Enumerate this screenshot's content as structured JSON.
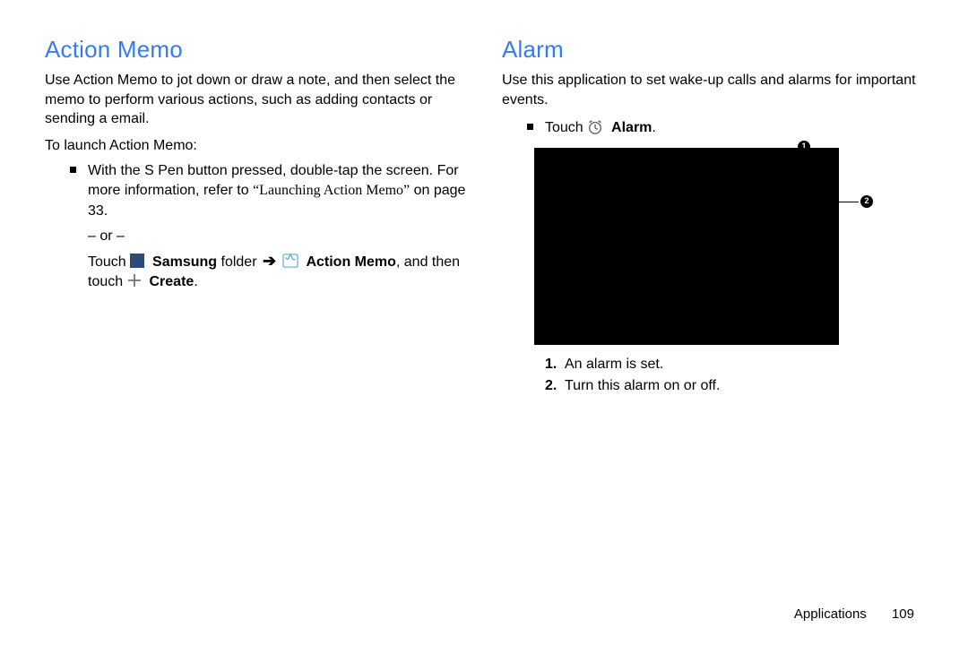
{
  "left": {
    "heading": "Action Memo",
    "intro": "Use Action Memo to jot down or draw a note, and then select the memo to perform various actions, such as adding contacts or sending a email.",
    "launch_label": "To launch Action Memo:",
    "bullet1_a": "With the S Pen button pressed, double-tap the screen. For more information, refer to ",
    "bullet1_ref_i": "“Launching Action Memo”",
    "bullet1_b": " on page 33.",
    "or": "– or –",
    "touch_word": "Touch ",
    "samsung_bold": "Samsung",
    "folder_word": " folder ",
    "action_memo_bold": "Action Memo",
    "and_then": ", and then touch ",
    "create_bold": "Create",
    "period": "."
  },
  "right": {
    "heading": "Alarm",
    "intro": "Use this application to set wake-up calls and alarms for important events.",
    "touch_word": "Touch ",
    "alarm_bold": "Alarm",
    "period": ".",
    "callout1": "1",
    "callout2": "2",
    "list": [
      {
        "n": "1.",
        "t": "An alarm is set."
      },
      {
        "n": "2.",
        "t": "Turn this alarm on or off."
      }
    ]
  },
  "footer": {
    "section": "Applications",
    "page": "109"
  }
}
